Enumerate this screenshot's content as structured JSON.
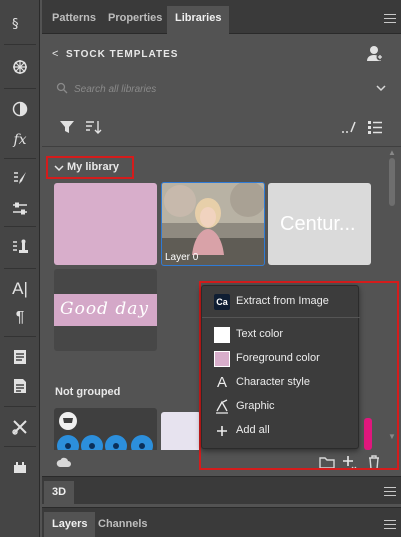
{
  "panel_tabs": [
    "Patterns",
    "Properties",
    "Libraries"
  ],
  "header": {
    "back_label": "<",
    "title": "STOCK TEMPLATES"
  },
  "search": {
    "placeholder": "Search all libraries"
  },
  "groups": {
    "my_library": "My library",
    "not_grouped": "Not grouped"
  },
  "assets": {
    "layer_label": "Layer 0",
    "century_text": "Centur...",
    "script_text": "Good day"
  },
  "menu": {
    "extract_badge": "Ca",
    "items": [
      {
        "label": "Extract from Image",
        "icon": "capture-icon"
      },
      {
        "label": "Text color",
        "icon": "white-swatch-icon"
      },
      {
        "label": "Foreground color",
        "icon": "pink-swatch-icon"
      },
      {
        "label": "Character style",
        "icon": "character-style-icon"
      },
      {
        "label": "Graphic",
        "icon": "graphic-icon"
      },
      {
        "label": "Add all",
        "icon": "plus-icon"
      }
    ]
  },
  "bottom_panels": {
    "three_d": "3D",
    "layers": "Layers",
    "channels": "Channels"
  },
  "colors": {
    "pink_swatch": "#d8aecb",
    "script_swatch": "#d4a8c8",
    "century_swatch": "#dadada",
    "highlight": "#d41c1c",
    "selection": "#2f7bd6"
  }
}
